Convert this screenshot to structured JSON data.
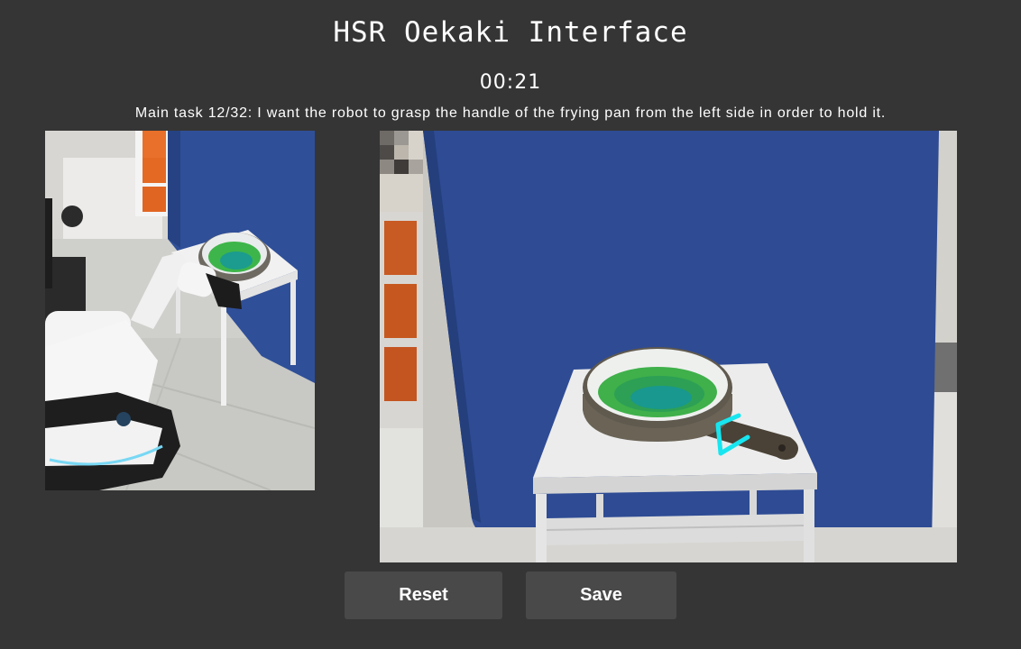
{
  "header": {
    "title": "HSR Oekaki Interface",
    "timer": "00:21",
    "task": "Main task 12/32: I want the robot to grasp the handle of the frying pan from the left side in order to hold it."
  },
  "views": {
    "left_image": "robot-side-view",
    "right_image": "head-camera-view",
    "stroke_color": "#17e6f0"
  },
  "buttons": {
    "reset": "Reset",
    "save": "Save"
  },
  "colors": {
    "background": "#353535",
    "button": "#494949"
  }
}
